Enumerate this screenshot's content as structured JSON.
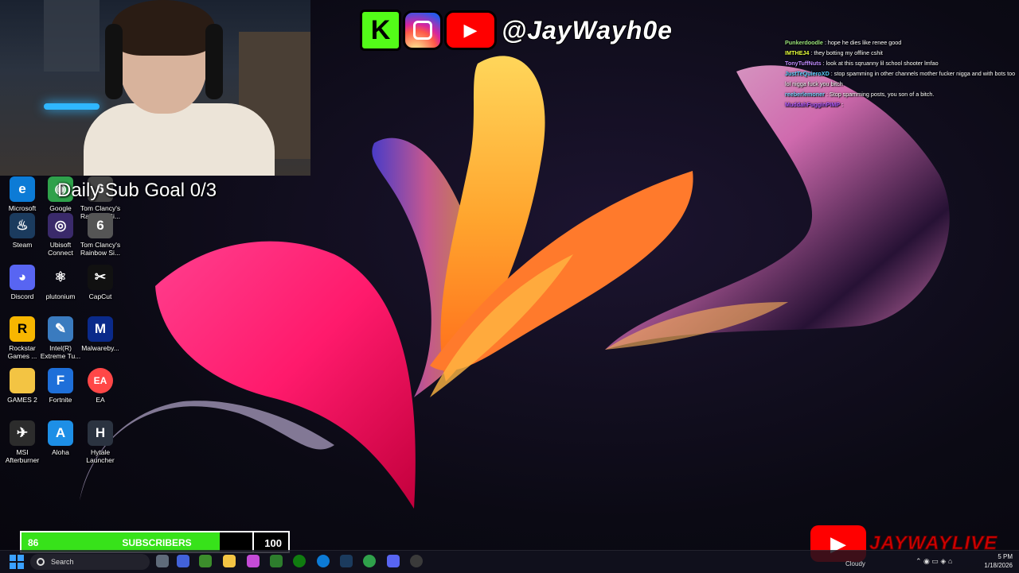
{
  "overlay": {
    "handle": "@JayWayh0e",
    "sub_goal": "Daily Sub Goal 0/3",
    "yt_live_text": "JAYWAYLIVE"
  },
  "subscriber_bar": {
    "current": "86",
    "label": "SUBSCRIBERS",
    "target": "100",
    "progress": 0.86,
    "fill_color": "#37e21a"
  },
  "chat": [
    {
      "user": "Punkerdoodle",
      "color": "#9be37b",
      "text": ": hope he dies like renee good"
    },
    {
      "user": "IMTHEJ4",
      "color": "#e8ff3b",
      "text": ": they botting my offline cshit"
    },
    {
      "user": "TonyTuffNuts",
      "color": "#c08cff",
      "text": ": look at this sqruanny lil school shooter lmfao"
    },
    {
      "user": "JustTeQuieroXD",
      "color": "#5ad0ff",
      "text": ": stop spamming in other channels mother fucker nigga and with bots too lol nigga fuck you bitch"
    },
    {
      "user": "reeberlemoner",
      "color": "#7ad1ff",
      "text": ": Stop spamming posts, you son of a bitch."
    },
    {
      "user": "MuddahFugginPIMP",
      "color": "#b25cff",
      "text": ": "
    }
  ],
  "desktop_icons": [
    {
      "label": "Microsoft Edge",
      "icon": "edge-icon",
      "glyph": "e",
      "bg": "#0c7bd6"
    },
    {
      "label": "Google Chrome",
      "icon": "chrome-icon",
      "glyph": "◉",
      "bg": "#2fa14b"
    },
    {
      "label": "Tom Clancy's Rainbow Si...",
      "icon": "rainbow-six-icon",
      "glyph": "6",
      "bg": "#444"
    },
    {
      "label": "Steam",
      "icon": "steam-icon",
      "glyph": "♨",
      "bg": "#1b3b5e"
    },
    {
      "label": "Ubisoft Connect",
      "icon": "ubisoft-icon",
      "glyph": "◎",
      "bg": "#3a2a6a"
    },
    {
      "label": "Tom Clancy's Rainbow Si...",
      "icon": "rainbow-six-icon",
      "glyph": "6",
      "bg": "#555"
    },
    {
      "label": "Discord",
      "icon": "discord-icon",
      "glyph": "◕",
      "bg": "#5865f2"
    },
    {
      "label": "plutonium",
      "icon": "plutonium-icon",
      "glyph": "⚛",
      "bg": "transparent"
    },
    {
      "label": "CapCut",
      "icon": "capcut-icon",
      "glyph": "✂",
      "bg": "#111"
    },
    {
      "label": "Rockstar Games ...",
      "icon": "rockstar-icon",
      "glyph": "R",
      "bg": "#f7b600"
    },
    {
      "label": "Intel(R) Extreme Tu...",
      "icon": "intel-xtu-icon",
      "glyph": "✎",
      "bg": "#3a7bbf"
    },
    {
      "label": "Malwareby...",
      "icon": "malwarebytes-icon",
      "glyph": "M",
      "bg": "#0a2a8a"
    },
    {
      "label": "GAMES 2",
      "icon": "folder-icon",
      "glyph": "",
      "bg": "#f3c443"
    },
    {
      "label": "Fortnite",
      "icon": "fortnite-icon",
      "glyph": "F",
      "bg": "#1e6fd9"
    },
    {
      "label": "EA",
      "icon": "ea-icon",
      "glyph": "EA",
      "bg": "#ff4747"
    },
    {
      "label": "MSI Afterburner",
      "icon": "msi-afterburner-icon",
      "glyph": "✈",
      "bg": "#2c2c2c"
    },
    {
      "label": "Aloha",
      "icon": "aloha-icon",
      "glyph": "A",
      "bg": "#1d8fe6"
    },
    {
      "label": "Hytale Launcher",
      "icon": "hytale-icon",
      "glyph": "H",
      "bg": "#2b3340"
    }
  ],
  "taskbar": {
    "search_placeholder": "Search",
    "weather": "Cloudy",
    "time": "5 PM",
    "date": "1/18/2026"
  }
}
